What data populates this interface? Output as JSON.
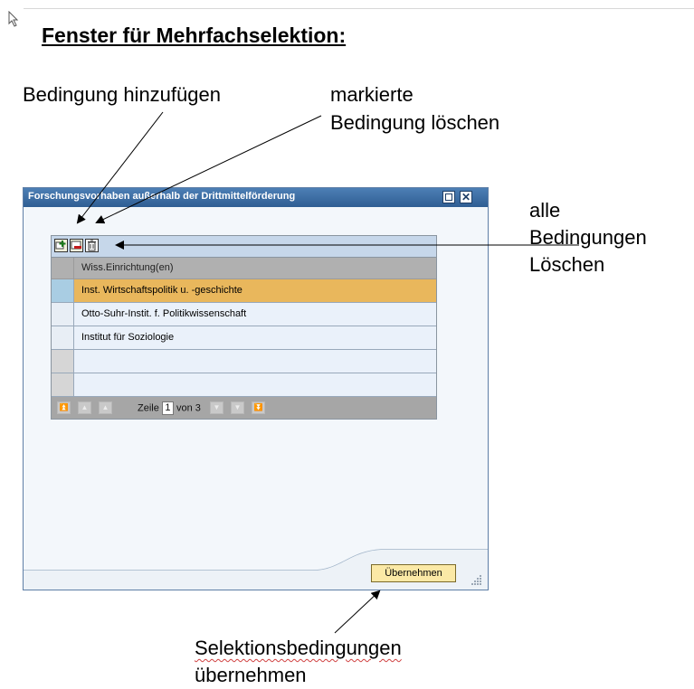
{
  "heading": "Fenster für Mehrfachselektion:",
  "annotations": {
    "add_condition": "Bedingung hinzufügen",
    "delete_marked_line1": "markierte",
    "delete_marked_line2": "Bedingung löschen",
    "delete_all_line1": "alle",
    "delete_all_line2": "Bedingungen",
    "delete_all_line3": "Löschen",
    "apply_line1": "Selektionsbedingungen",
    "apply_line2": "übernehmen"
  },
  "window": {
    "title": "Forschungsvorhaben außerhalb der Drittmittelförderung",
    "close_glyph": "✕"
  },
  "table": {
    "column_header": "Wiss.Einrichtung(en)",
    "rows": [
      "Inst. Wirtschaftspolitik u. -geschichte",
      "Otto-Suhr-Instit. f. Politikwissenschaft",
      "Institut für Soziologie",
      "",
      ""
    ],
    "pager": {
      "row_label": "Zeile",
      "current": "1",
      "of_label": "von 3"
    }
  },
  "buttons": {
    "apply": "Übernehmen"
  },
  "icons": [
    "add-row-icon",
    "delete-row-icon",
    "trash-icon",
    "window-minimize-icon",
    "window-close-icon",
    "scroll-first-icon",
    "scroll-page-up-icon",
    "scroll-up-icon",
    "scroll-down-icon",
    "scroll-page-down-icon",
    "scroll-last-icon",
    "resize-grip-icon"
  ],
  "colors": {
    "titlebar": "#3b6ea5",
    "selected_row": "#e9b75c",
    "button": "#fbe9a6"
  }
}
